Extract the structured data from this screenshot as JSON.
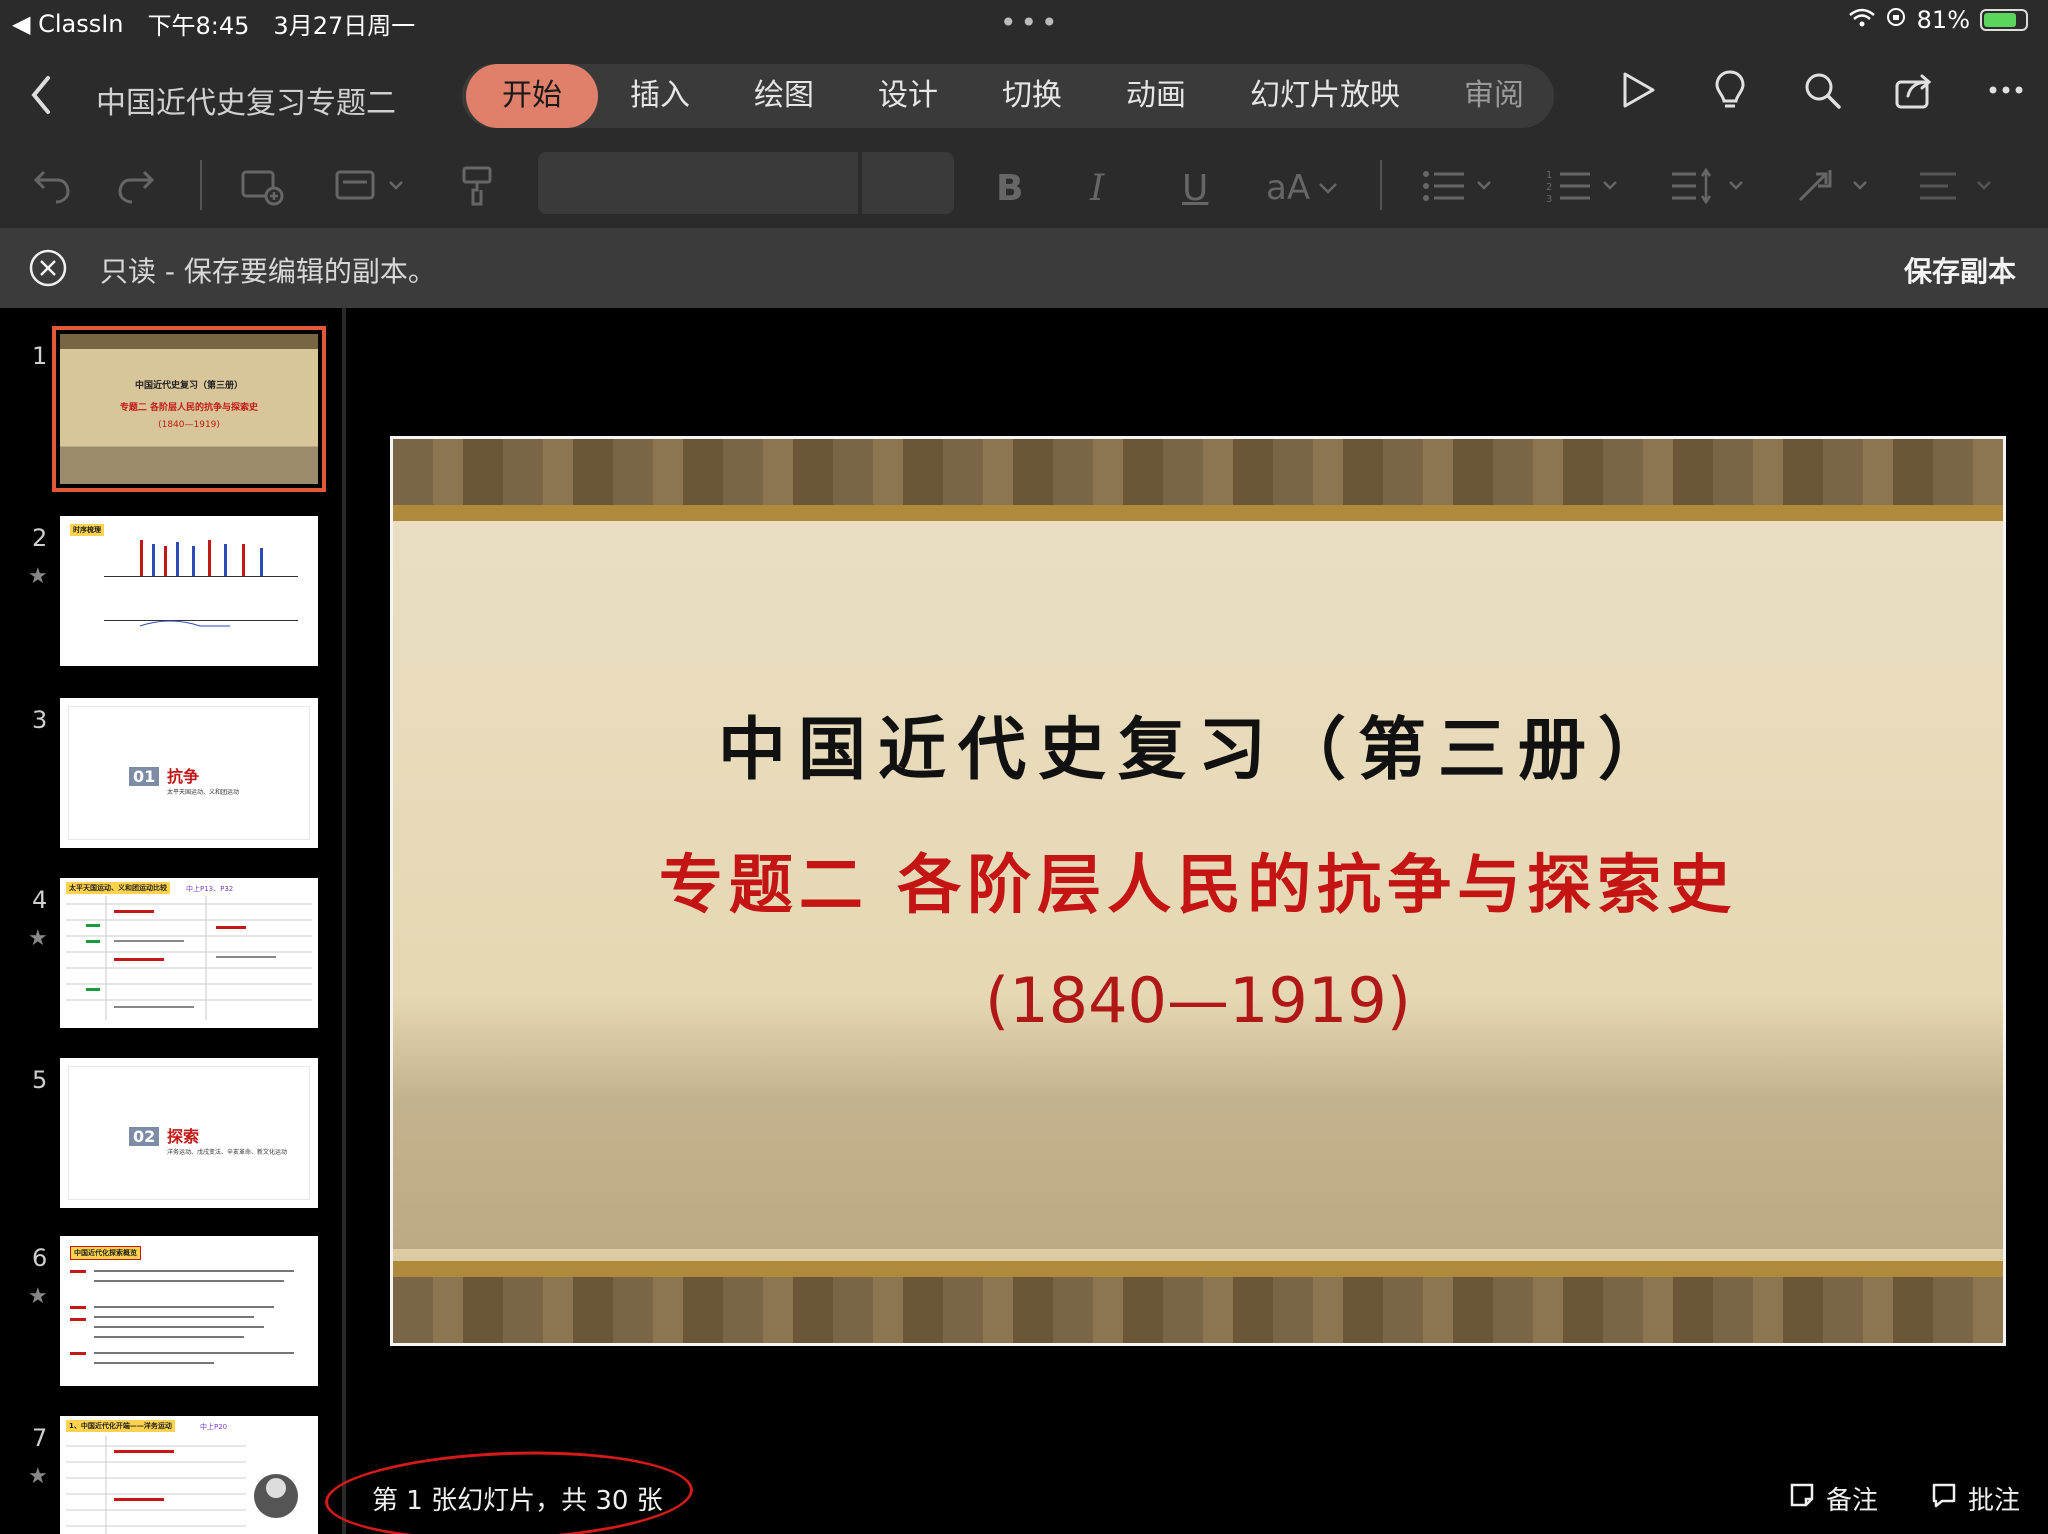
{
  "status": {
    "back_app": "◀ ClassIn",
    "time": "下午8:45",
    "date": "3月27日周一",
    "battery": "81%",
    "battery_level": 0.81
  },
  "header": {
    "doc_title": "中国近代史复习专题二",
    "tabs": [
      "开始",
      "插入",
      "绘图",
      "设计",
      "切换",
      "动画",
      "幻灯片放映",
      "审阅"
    ],
    "active_tab": "开始"
  },
  "toolbar": {
    "text_size_label": "aA"
  },
  "readonly_bar": {
    "message": "只读 - 保存要编辑的副本。",
    "save_copy": "保存副本"
  },
  "thumbnails": [
    {
      "num": "1",
      "title": "中国近代史复习（第三册）",
      "subtitle": "专题二 各阶层人民的抗争与探索史",
      "years": "(1840—1919)"
    },
    {
      "num": "2",
      "label": "时序梳理"
    },
    {
      "num": "3",
      "section_no": "01",
      "section_title": "抗争",
      "section_sub": "太平天国运动、义和团运动"
    },
    {
      "num": "4",
      "label": "太平天国运动、义和团运动比较",
      "ref": "中上P13、P32"
    },
    {
      "num": "5",
      "section_no": "02",
      "section_title": "探索",
      "section_sub": "洋务运动、戊戌变法、辛亥革命、新文化运动"
    },
    {
      "num": "6",
      "label": "中国近代化探索概览"
    },
    {
      "num": "7",
      "label": "1、中国近代化开端——洋务运动",
      "ref": "中上P20"
    }
  ],
  "slide": {
    "title": "中国近代史复习（第三册）",
    "subtitle": "专题二 各阶层人民的抗争与探索史",
    "years": "(1840—1919)"
  },
  "footer": {
    "slide_counter": "第 1 张幻灯片，共 30 张",
    "notes": "备注",
    "comments": "批注"
  },
  "colors": {
    "accent_tab": "#e0806a",
    "title_red": "#c41414",
    "selection": "#e05a3a"
  }
}
